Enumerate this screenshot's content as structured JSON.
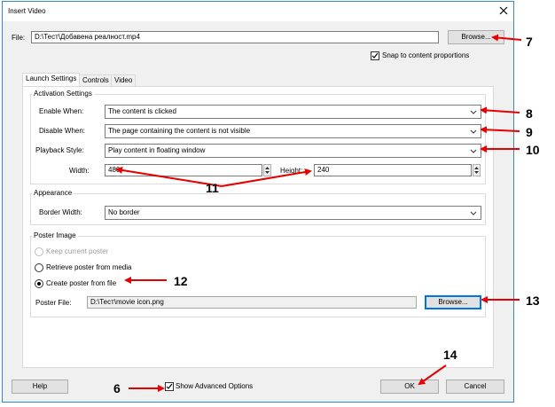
{
  "window": {
    "title": "Insert Video"
  },
  "file": {
    "label": "File:",
    "value": "D:\\Тест\\Добавена реалност.mp4",
    "browse_label": "Browse..."
  },
  "snap": {
    "label": "Snap to content proportions",
    "checked": true
  },
  "tabs": [
    {
      "label": "Launch Settings",
      "active": true
    },
    {
      "label": "Controls",
      "active": false
    },
    {
      "label": "Video",
      "active": false
    }
  ],
  "activation": {
    "title": "Activation Settings",
    "enable_label": "Enable When:",
    "enable_value": "The content is clicked",
    "disable_label": "Disable When:",
    "disable_value": "The page containing the content is not visible",
    "playback_label": "Playback Style:",
    "playback_value": "Play content in floating window",
    "width_label": "Width:",
    "width_value": "480",
    "height_label": "Height:",
    "height_value": "240"
  },
  "appearance": {
    "title": "Appearance",
    "border_label": "Border Width:",
    "border_value": "No border"
  },
  "poster": {
    "title": "Poster Image",
    "option_keep": "Keep current poster",
    "option_retrieve": "Retrieve poster from media",
    "option_create": "Create poster from file",
    "selected": "create",
    "file_label": "Poster File:",
    "file_value": "D:\\Тест\\movie icon.png",
    "browse_label": "Browse..."
  },
  "footer": {
    "help_label": "Help",
    "advanced_label": "Show Advanced Options",
    "advanced_checked": true,
    "ok_label": "OK",
    "cancel_label": "Cancel"
  },
  "callouts": {
    "c6": "6",
    "c7": "7",
    "c8": "8",
    "c9": "9",
    "c10": "10",
    "c11": "11",
    "c12": "12",
    "c13": "13",
    "c14": "14"
  },
  "colors": {
    "annotation": "#e60000",
    "focus": "#0078d7",
    "dialog_bg": "#f0f0f0"
  }
}
